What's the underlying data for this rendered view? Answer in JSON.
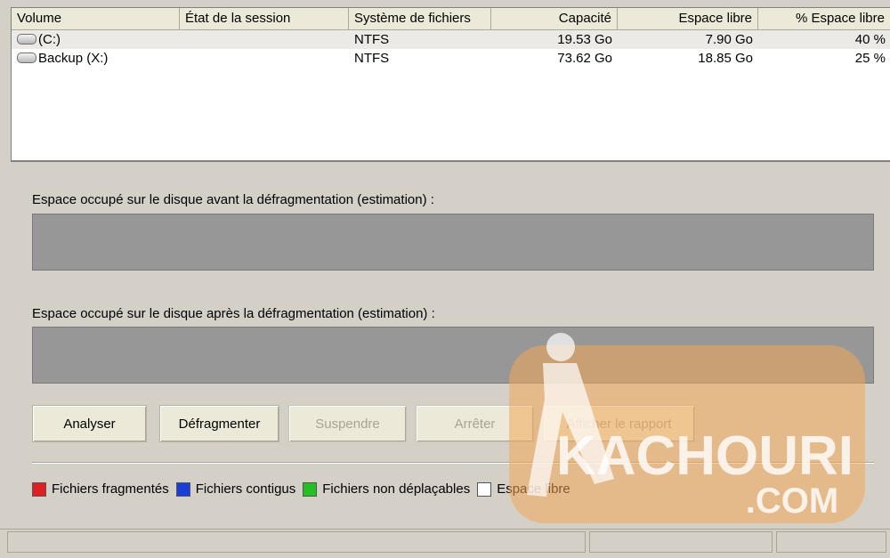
{
  "volume_list": {
    "columns": [
      "Volume",
      "État de la session",
      "Système de fichiers",
      "Capacité",
      "Espace libre",
      "% Espace libre"
    ],
    "rows": [
      {
        "volume": "(C:)",
        "session": "",
        "filesystem": "NTFS",
        "capacity": "19.53 Go",
        "free": "7.90 Go",
        "pct_free": "40 %"
      },
      {
        "volume": "Backup (X:)",
        "session": "",
        "filesystem": "NTFS",
        "capacity": "73.62 Go",
        "free": "18.85 Go",
        "pct_free": "25 %"
      }
    ]
  },
  "before_label": "Espace occupé sur le disque avant la défragmentation (estimation) :",
  "after_label": "Espace occupé sur le disque après la défragmentation (estimation) :",
  "buttons": {
    "analyze": "Analyser",
    "defragment": "Défragmenter",
    "pause": "Suspendre",
    "stop": "Arrêter",
    "report": "Afficher le rapport"
  },
  "legend": {
    "fragmented": {
      "label": "Fichiers fragmentés",
      "color": "#e02020"
    },
    "contiguous": {
      "label": "Fichiers contigus",
      "color": "#1a3cd8"
    },
    "unmovable": {
      "label": "Fichiers non déplaçables",
      "color": "#22c022"
    },
    "free": {
      "label": "Espace libre",
      "color": "#ffffff"
    }
  },
  "watermark": {
    "text": "KACHOURI",
    "suffix": ".COM",
    "color": "#f0a050"
  },
  "icons": {
    "drive": "drive-icon"
  }
}
